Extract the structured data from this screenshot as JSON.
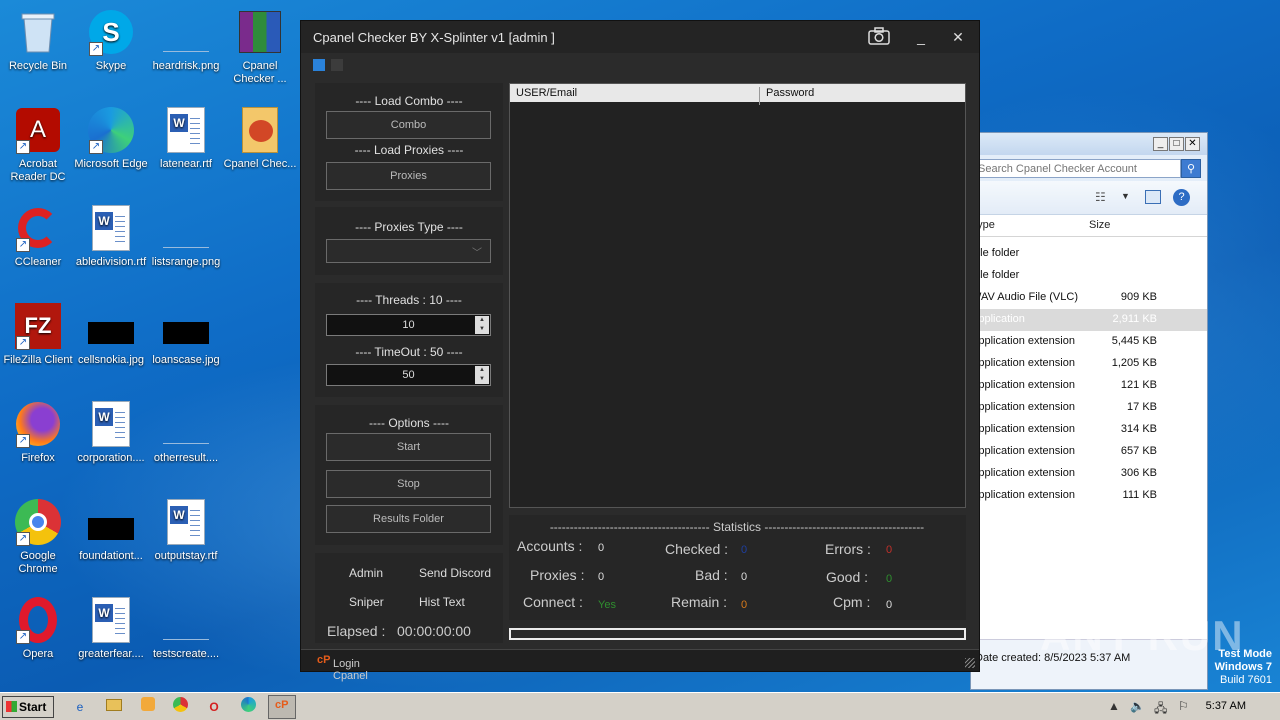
{
  "desktop": {
    "icons": [
      {
        "label": "Recycle Bin",
        "icon": "recycle-bin-icon"
      },
      {
        "label": "Skype",
        "icon": "skype-icon"
      },
      {
        "label": "heardrisk.png",
        "icon": "image-file-icon"
      },
      {
        "label": "Cpanel Checker ...",
        "icon": "winrar-archive-icon"
      },
      {
        "label": "Acrobat Reader DC",
        "icon": "acrobat-icon"
      },
      {
        "label": "Microsoft Edge",
        "icon": "edge-icon"
      },
      {
        "label": "latenear.rtf",
        "icon": "word-doc-icon"
      },
      {
        "label": "Cpanel Chec...",
        "icon": "powerpoint-icon"
      },
      {
        "label": "CCleaner",
        "icon": "ccleaner-icon"
      },
      {
        "label": "abledivision.rtf",
        "icon": "word-doc-icon"
      },
      {
        "label": "listsrange.png",
        "icon": "image-file-icon"
      },
      {
        "label": "FileZilla Client",
        "icon": "filezilla-icon"
      },
      {
        "label": "cellsnokia.jpg",
        "icon": "image-file-icon"
      },
      {
        "label": "loanscase.jpg",
        "icon": "image-file-icon"
      },
      {
        "label": "Firefox",
        "icon": "firefox-icon"
      },
      {
        "label": "corporation....",
        "icon": "word-doc-icon"
      },
      {
        "label": "otherresult....",
        "icon": "image-file-icon"
      },
      {
        "label": "Google Chrome",
        "icon": "chrome-icon"
      },
      {
        "label": "foundationt...",
        "icon": "image-file-icon"
      },
      {
        "label": "outputstay.rtf",
        "icon": "word-doc-icon"
      },
      {
        "label": "Opera",
        "icon": "opera-icon"
      },
      {
        "label": "greaterfear....",
        "icon": "word-doc-icon"
      },
      {
        "label": "testscreate....",
        "icon": "image-file-icon"
      }
    ]
  },
  "explorer": {
    "search_placeholder": "Search Cpanel Checker Account",
    "columns": [
      "Type",
      "Size"
    ],
    "rows": [
      {
        "type": "File folder",
        "size": ""
      },
      {
        "type": "File folder",
        "size": ""
      },
      {
        "type": "WAV Audio File (VLC)",
        "size": "909 KB"
      },
      {
        "type": "Application",
        "size": "2,911 KB"
      },
      {
        "type": "Application extension",
        "size": "5,445 KB"
      },
      {
        "type": "Application extension",
        "size": "1,205 KB"
      },
      {
        "type": "Application extension",
        "size": "121 KB"
      },
      {
        "type": "Application extension",
        "size": "17 KB"
      },
      {
        "type": "Application extension",
        "size": "314 KB"
      },
      {
        "type": "Application extension",
        "size": "657 KB"
      },
      {
        "type": "Application extension",
        "size": "306 KB"
      },
      {
        "type": "Application extension",
        "size": "111 KB"
      }
    ],
    "status": "Date created: 8/5/2023 5:37 AM"
  },
  "app": {
    "title": "Cpanel Checker BY X-Splinter v1 [admin ]",
    "load_combo_title": "---- Load Combo ----",
    "combo_button": "Combo",
    "load_proxies_title": "---- Load Proxies ----",
    "proxies_button": "Proxies",
    "proxies_type_title": "---- Proxies Type ----",
    "threads_title": "---- Threads : 10 ----",
    "threads_value": "10",
    "timeout_title": "---- TimeOut : 50 ----",
    "timeout_value": "50",
    "options_title": "---- Options ----",
    "start_button": "Start",
    "stop_button": "Stop",
    "results_button": "Results Folder",
    "checkboxes": {
      "admin": "Admin",
      "send_discord": "Send Discord",
      "sniper": "Sniper",
      "hist_text": "Hist Text"
    },
    "elapsed_label": "Elapsed :",
    "elapsed_value": "00:00:00:00",
    "grid_columns": [
      "USER/Email",
      "Password"
    ],
    "statistics_title": "---------------------------------------- Statistics ----------------------------------------",
    "stats": {
      "accounts_label": "Accounts :",
      "accounts_value": "0",
      "checked_label": "Checked :",
      "checked_value": "0",
      "errors_label": "Errors :",
      "errors_value": "0",
      "proxies_label": "Proxies :",
      "proxies_value": "0",
      "bad_label": "Bad :",
      "bad_value": "0",
      "good_label": "Good :",
      "good_value": "0",
      "connect_label": "Connect :",
      "connect_value": "Yes",
      "remain_label": "Remain :",
      "remain_value": "0",
      "cpm_label": "Cpm :",
      "cpm_value": "0"
    },
    "progress": 0,
    "status_link": "Login Cpanel"
  },
  "taskbar": {
    "start_label": "Start",
    "clock": "5:37 AM"
  },
  "watermark": {
    "line1": "Test Mode",
    "line2": "Windows 7",
    "line3": "Build 7601",
    "brand": "ANY RUN"
  },
  "colors": {
    "accent": "#2a82da",
    "checked_value": "#1e3fa0",
    "errors_value": "#c0302a",
    "good_value": "#2f8f2f",
    "connect_value": "#2f8f2f",
    "remain_value": "#d97a1a"
  }
}
